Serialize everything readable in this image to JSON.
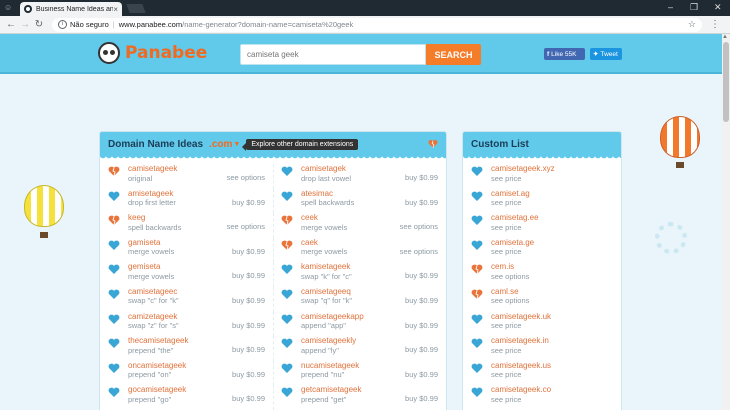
{
  "browser": {
    "tab_title": "Business Name Ideas an",
    "tab_close": "×",
    "security_label": "Não seguro",
    "url_host": "www.panabee.com",
    "url_path": "/name-generator?domain-name=camiseta%20geek",
    "window_controls": [
      "–",
      "❐",
      "✕"
    ]
  },
  "header": {
    "logo_text": "Panabee",
    "search_placeholder": "camiseta geek",
    "search_button": "SEARCH",
    "fb_label": "Like 55K",
    "tw_label": "Tweet"
  },
  "main_panel": {
    "title": "Domain Name Ideas",
    "tld": ".com",
    "tooltip": "Explore other domain extensions",
    "rows": [
      [
        {
          "name": "camisetageek",
          "desc": "original",
          "price": "see options",
          "heart": "broken"
        },
        {
          "name": "camisetagek",
          "desc": "drop last vowel",
          "price": "buy $0.99",
          "heart": "blue"
        }
      ],
      [
        {
          "name": "amisetageek",
          "desc": "drop first letter",
          "price": "buy $0.99",
          "heart": "blue"
        },
        {
          "name": "atesimac",
          "desc": "spell backwards",
          "price": "buy $0.99",
          "heart": "blue"
        }
      ],
      [
        {
          "name": "keeg",
          "desc": "spell backwards",
          "price": "see options",
          "heart": "broken"
        },
        {
          "name": "ceek",
          "desc": "merge vowels",
          "price": "see options",
          "heart": "broken"
        }
      ],
      [
        {
          "name": "gamiseta",
          "desc": "merge vowels",
          "price": "buy $0.99",
          "heart": "blue"
        },
        {
          "name": "caek",
          "desc": "merge vowels",
          "price": "see options",
          "heart": "broken"
        }
      ],
      [
        {
          "name": "gemiseta",
          "desc": "merge vowels",
          "price": "buy $0.99",
          "heart": "blue"
        },
        {
          "name": "kamisetageek",
          "desc": "swap \"k\" for \"c\"",
          "price": "buy $0.99",
          "heart": "blue"
        }
      ],
      [
        {
          "name": "camisetageec",
          "desc": "swap \"c\" for \"k\"",
          "price": "buy $0.99",
          "heart": "blue"
        },
        {
          "name": "camisetageeq",
          "desc": "swap \"q\" for \"k\"",
          "price": "buy $0.99",
          "heart": "blue"
        }
      ],
      [
        {
          "name": "camizetageek",
          "desc": "swap \"z\" for \"s\"",
          "price": "buy $0.99",
          "heart": "blue"
        },
        {
          "name": "camisetageekapp",
          "desc": "append \"app\"",
          "price": "buy $0.99",
          "heart": "blue"
        }
      ],
      [
        {
          "name": "thecamisetageek",
          "desc": "prepend \"the\"",
          "price": "buy $0.99",
          "heart": "blue"
        },
        {
          "name": "camisetageekly",
          "desc": "append \"ly\"",
          "price": "buy $0.99",
          "heart": "blue"
        }
      ],
      [
        {
          "name": "oncamisetageek",
          "desc": "prepend \"on\"",
          "price": "buy $0.99",
          "heart": "blue"
        },
        {
          "name": "nucamisetageek",
          "desc": "prepend \"nu\"",
          "price": "buy $0.99",
          "heart": "blue"
        }
      ],
      [
        {
          "name": "gocamisetageek",
          "desc": "prepend \"go\"",
          "price": "buy $0.99",
          "heart": "blue"
        },
        {
          "name": "getcamisetageek",
          "desc": "prepend \"get\"",
          "price": "buy $0.99",
          "heart": "blue"
        }
      ]
    ]
  },
  "side_panel": {
    "title": "Custom List",
    "items": [
      {
        "name": "camisetageek.xyz",
        "desc": "see price",
        "heart": "blue"
      },
      {
        "name": "camiset.ag",
        "desc": "see price",
        "heart": "blue"
      },
      {
        "name": "camisetag.ee",
        "desc": "see price",
        "heart": "blue"
      },
      {
        "name": "camiseta.ge",
        "desc": "see price",
        "heart": "blue"
      },
      {
        "name": "cem.is",
        "desc": "see options",
        "heart": "broken"
      },
      {
        "name": "caml.se",
        "desc": "see options",
        "heart": "broken"
      },
      {
        "name": "camisetageek.uk",
        "desc": "see price",
        "heart": "blue"
      },
      {
        "name": "camisetageek.in",
        "desc": "see price",
        "heart": "blue"
      },
      {
        "name": "camisetageek.us",
        "desc": "see price",
        "heart": "blue"
      },
      {
        "name": "camisetageek.co",
        "desc": "see price",
        "heart": "blue"
      }
    ]
  },
  "colors": {
    "brand_orange": "#f16a21",
    "header_blue": "#61c9ea",
    "heart_blue": "#3aa6d6",
    "heart_broken": "#e8743b"
  }
}
